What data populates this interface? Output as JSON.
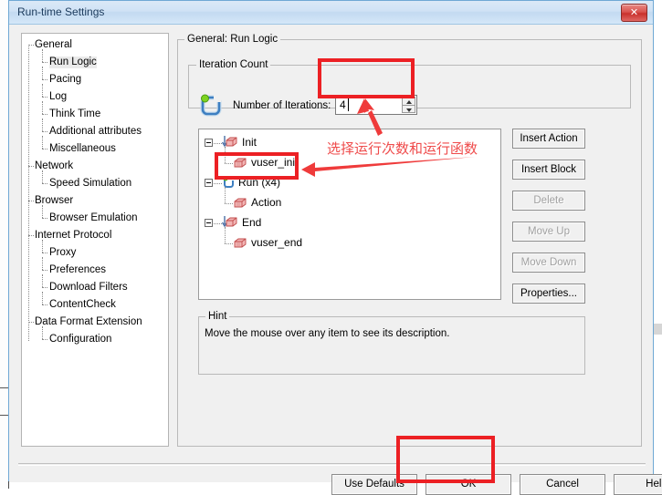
{
  "window": {
    "title": "Run-time Settings",
    "close_label": "✕"
  },
  "sidebar": {
    "items": [
      {
        "label": "General",
        "level": 0,
        "selected": false
      },
      {
        "label": "Run Logic",
        "level": 1,
        "selected": true
      },
      {
        "label": "Pacing",
        "level": 1,
        "selected": false
      },
      {
        "label": "Log",
        "level": 1,
        "selected": false
      },
      {
        "label": "Think Time",
        "level": 1,
        "selected": false
      },
      {
        "label": "Additional attributes",
        "level": 1,
        "selected": false
      },
      {
        "label": "Miscellaneous",
        "level": 1,
        "selected": false
      },
      {
        "label": "Network",
        "level": 0,
        "selected": false
      },
      {
        "label": "Speed Simulation",
        "level": 1,
        "selected": false
      },
      {
        "label": "Browser",
        "level": 0,
        "selected": false
      },
      {
        "label": "Browser Emulation",
        "level": 1,
        "selected": false
      },
      {
        "label": "Internet Protocol",
        "level": 0,
        "selected": false
      },
      {
        "label": "Proxy",
        "level": 1,
        "selected": false
      },
      {
        "label": "Preferences",
        "level": 1,
        "selected": false
      },
      {
        "label": "Download Filters",
        "level": 1,
        "selected": false
      },
      {
        "label": "ContentCheck",
        "level": 1,
        "selected": false
      },
      {
        "label": "Data Format Extension",
        "level": 0,
        "selected": false
      },
      {
        "label": "Configuration",
        "level": 1,
        "selected": false
      }
    ]
  },
  "main": {
    "group_caption": "General: Run Logic",
    "iteration": {
      "group_caption": "Iteration Count",
      "field_label": "Number of Iterations:",
      "value": "4",
      "icon": "iteration-loop-icon"
    },
    "run_logic_tree": [
      {
        "label": "Init",
        "level": 0,
        "icon": "init-block-icon",
        "expander": true,
        "selected": false
      },
      {
        "label": "vuser_init",
        "level": 1,
        "icon": "action-block-icon",
        "expander": false,
        "selected": false
      },
      {
        "label": "Run (x4)",
        "level": 0,
        "icon": "run-loop-icon",
        "expander": true,
        "selected": false
      },
      {
        "label": "Action",
        "level": 1,
        "icon": "action-block-icon",
        "expander": false,
        "selected": true
      },
      {
        "label": "End",
        "level": 0,
        "icon": "end-block-icon",
        "expander": true,
        "selected": false
      },
      {
        "label": "vuser_end",
        "level": 1,
        "icon": "action-block-icon",
        "expander": false,
        "selected": false
      }
    ],
    "side_buttons": [
      {
        "label": "Insert Action",
        "enabled": true
      },
      {
        "label": "Insert Block",
        "enabled": true
      },
      {
        "label": "Delete",
        "enabled": false
      },
      {
        "label": "Move Up",
        "enabled": false
      },
      {
        "label": "Move Down",
        "enabled": false
      },
      {
        "label": "Properties...",
        "enabled": true
      }
    ],
    "hint": {
      "caption": "Hint",
      "text": "Move the mouse over any item to see its description."
    }
  },
  "footer": {
    "buttons": [
      {
        "label": "Use Defaults"
      },
      {
        "label": "OK"
      },
      {
        "label": "Cancel"
      },
      {
        "label": "Help"
      }
    ]
  },
  "annotations": {
    "note_text": "选择运行次数和运行函数",
    "highlight_color": "#ec2024",
    "note_color": "#ef4b4b",
    "boxes": [
      "iteration-input-highlight",
      "action-row-highlight",
      "ok-button-highlight"
    ]
  }
}
